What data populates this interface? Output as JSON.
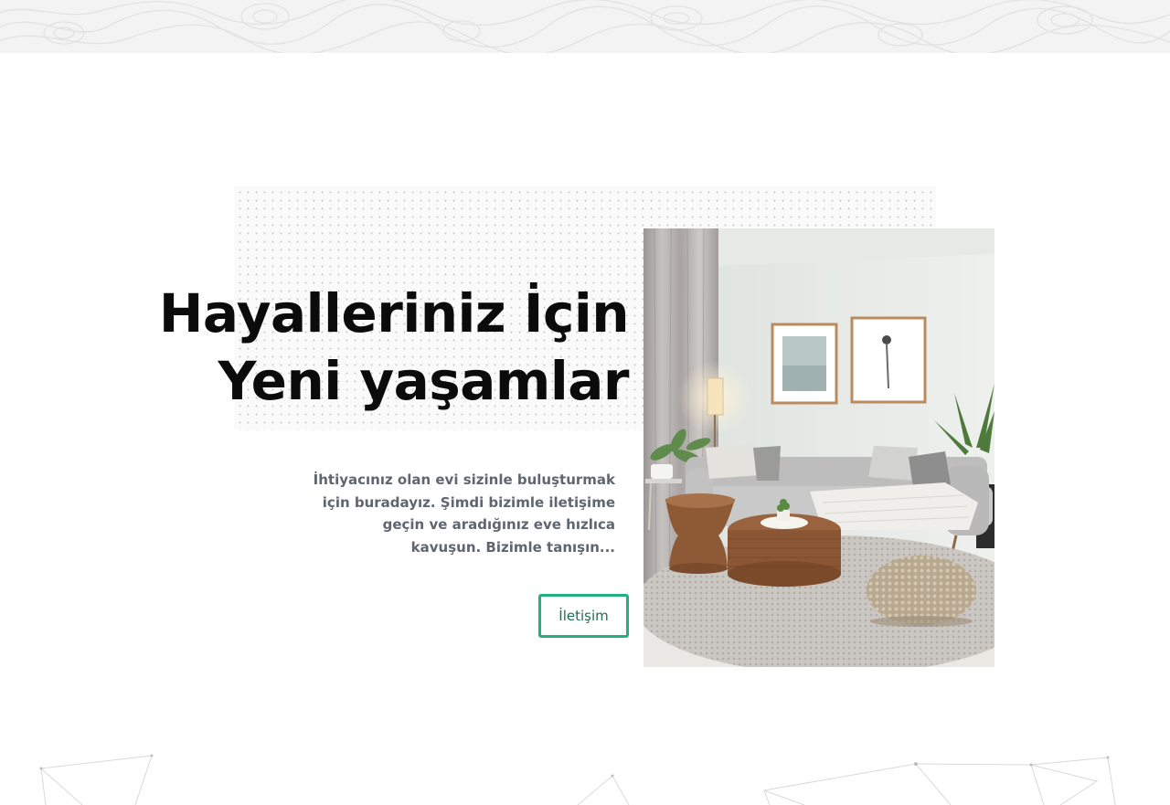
{
  "hero": {
    "title_line_1": "Hayalleriniz İçin",
    "title_line_2": "Yeni yaşamlar",
    "description": "İhtiyacınız olan evi sizinle buluşturmak için buradayız. Şimdi bizimle iletişime geçin ve aradığınız eve hızlıca kavuşun. Bizimle tanışın...",
    "cta_label": "İletişim"
  },
  "colors": {
    "accent": "#22b07d",
    "cta_text": "#1d6e55",
    "heading": "#0b0b0b",
    "body_text": "#5f6670",
    "top_band": "#f3f3f3"
  }
}
